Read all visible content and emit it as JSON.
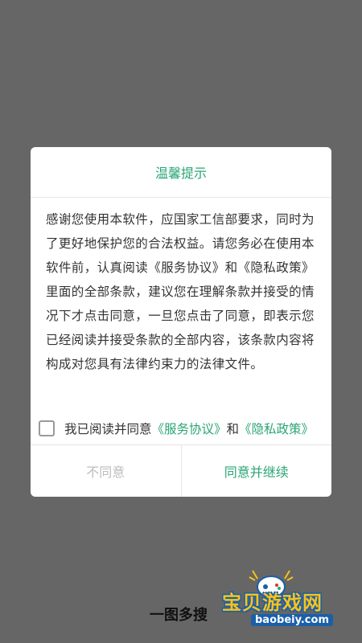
{
  "dialog": {
    "title": "温馨提示",
    "body": "感谢您使用本软件，应国家工信部要求，同时为了更好地保护您的合法权益。请您务必在使用本软件前，认真阅读《服务协议》和《隐私政策》里面的全部条款，建议您在理解条款并接受的情况下才点击同意，一旦您点击了同意，即表示您已经阅读并接受条款的全部内容，该条款内容将构成对您具有法律约束力的法律文件。",
    "agree_prefix": "我已阅读并同意",
    "service_link": "《服务协议》",
    "and_text": "和",
    "privacy_link": "《隐私政策》",
    "checkbox_checked": false,
    "disagree_label": "不同意",
    "agree_label": "同意并继续"
  },
  "bottom_label": "一图多搜",
  "watermark": {
    "text": "宝贝游戏网",
    "url": "baobeiy.com"
  },
  "colors": {
    "accent": "#2aa574",
    "overlay": "#666666",
    "disabled_text": "#bcbcbc"
  }
}
